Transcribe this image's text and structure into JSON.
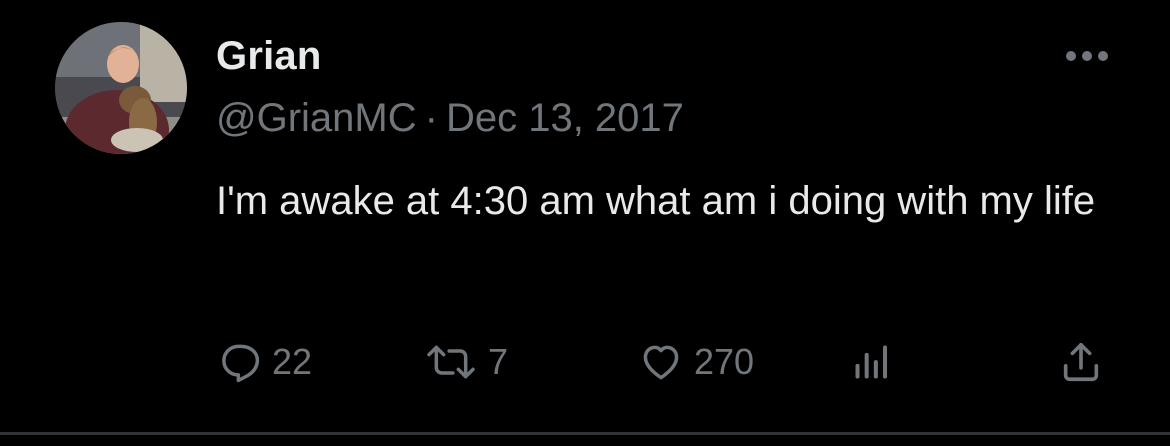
{
  "tweet": {
    "author_name": "Grian",
    "handle": "@GrianMC",
    "separator": "·",
    "date": "Dec 13, 2017",
    "text": "I'm awake at 4:30 am what am i doing with my life",
    "replies": "22",
    "retweets": "7",
    "likes": "270"
  },
  "icons": {
    "avatar": "avatar",
    "more": "more-icon",
    "reply": "reply-icon",
    "retweet": "retweet-icon",
    "like": "like-icon",
    "views": "views-icon",
    "share": "share-icon"
  },
  "colors": {
    "background": "#000000",
    "primary_text": "#e7e9ea",
    "secondary_text": "#71767b",
    "divider": "#2f3336"
  }
}
